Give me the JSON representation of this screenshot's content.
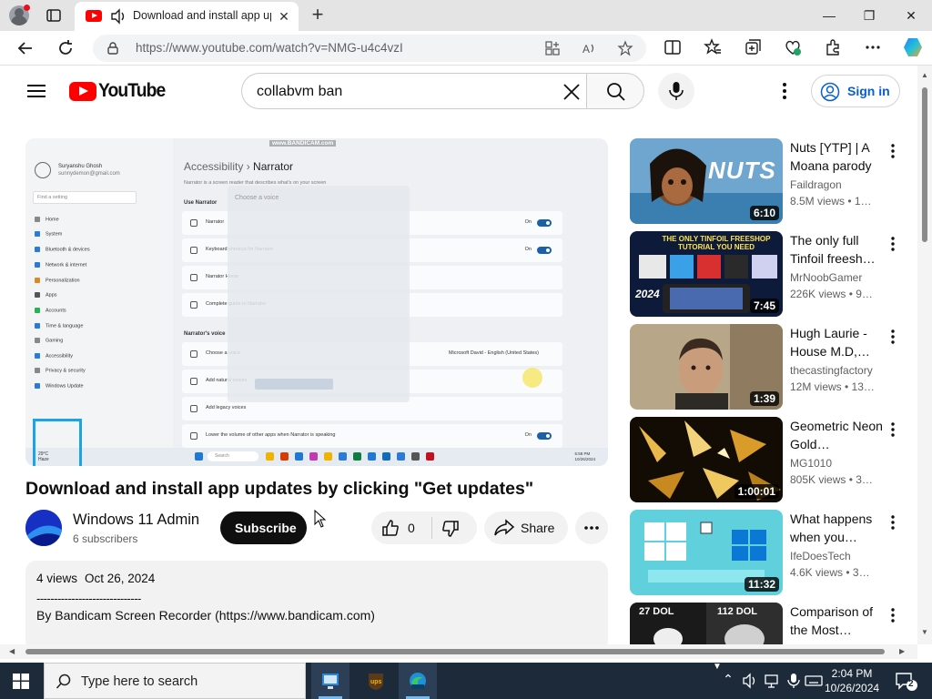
{
  "browser": {
    "tab": {
      "title": "Download and install app updates by clicking \"Get updates\""
    },
    "url": "https://www.youtube.com/watch?v=NMG-u4c4vzI"
  },
  "youtube": {
    "logo_text": "YouTube",
    "search_value": "collabvm ban",
    "signin_label": "Sign in"
  },
  "video": {
    "title": "Download and install app updates by clicking \"Get updates\"",
    "channel": "Windows 11 Admin",
    "subscribers": "6 subscribers",
    "subscribe_label": "Subscribe",
    "like_count": "0",
    "share_label": "Share",
    "views": "4 views",
    "date": "Oct 26, 2024",
    "desc_rule": "------------------------------",
    "desc_text": "By Bandicam Screen Recorder (https://www.bandicam.com)",
    "frame": {
      "watermark": "www.BANDICAM.com",
      "user_name": "Suryanshu Ghosh",
      "user_email": "sunnydemon@gmail.com",
      "find_setting": "Find a setting",
      "nav_items": [
        "Home",
        "System",
        "Bluetooth & devices",
        "Network & internet",
        "Personalization",
        "Apps",
        "Accounts",
        "Time & language",
        "Gaming",
        "Accessibility",
        "Privacy & security",
        "Windows Update"
      ],
      "breadcrumb_parent": "Accessibility",
      "breadcrumb_current": "Narrator",
      "subtitle": "Narrator is a screen reader that describes what's on your screen",
      "section_use": "Use Narrator",
      "section_voice": "Narrator's voice",
      "rows": [
        "Narrator",
        "Keyboard shortcut for Narrator",
        "Narrator Home",
        "Complete guide to Narrator",
        "Choose a voice",
        "Add natural voices",
        "Add legacy voices",
        "Lower the volume of other apps when Narrator is speaking"
      ],
      "toggle_state": "On",
      "voice_value": "Microsoft David - English (United States)",
      "dialog_title": "Choose a voice",
      "taskbar_search": "Search",
      "clock_lines": [
        "5:58 PM",
        "10/26/2024"
      ],
      "cam_label": "29°C",
      "cam_sub": "Haze"
    }
  },
  "recommendations": [
    {
      "title": "Nuts [YTP] | A Moana parody",
      "channel": "Faildragon",
      "views": "8.5M views • 1…",
      "duration": "6:10",
      "thumb_color": "#5b8fb8",
      "thumb_text": "NUTS"
    },
    {
      "title": "The only full Tinfoil freesh…",
      "channel": "MrNoobGamer",
      "views": "226K views • 9…",
      "duration": "7:45",
      "thumb_color": "#0e1a3a",
      "thumb_text": "THE ONLY TINFOIL FREESHOP TUTORIAL YOU NEED",
      "thumb_year": "2024"
    },
    {
      "title": "Hugh Laurie - House M.D,…",
      "channel": "thecastingfactory",
      "views": "12M views • 13…",
      "duration": "1:39",
      "thumb_color": "#8a7a62"
    },
    {
      "title": "Geometric Neon Gold…",
      "channel": "MG1010",
      "views": "805K views • 3…",
      "duration": "1:00:01",
      "thumb_color": "#1a1206"
    },
    {
      "title": "What happens when you…",
      "channel": "IfeDoesTech",
      "views": "4.6K views • 3…",
      "duration": "11:32",
      "thumb_color": "#5fd0dc"
    },
    {
      "title": "Comparison of the Most…",
      "channel": "",
      "views": "",
      "duration": "",
      "thumb_color": "#2a2a2a",
      "thumb_labels": [
        "27 DOL",
        "112 DOL"
      ]
    }
  ],
  "taskbar": {
    "search_placeholder": "Type here to search",
    "time": "2:04 PM",
    "date": "10/26/2024",
    "notification_count": "2"
  }
}
